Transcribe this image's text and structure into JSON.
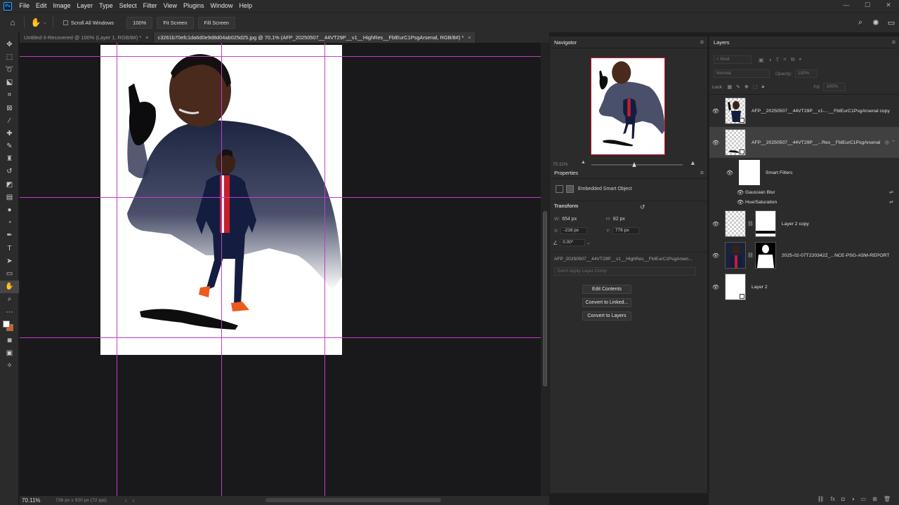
{
  "app": {
    "logo": "Ps",
    "menus": [
      "File",
      "Edit",
      "Image",
      "Layer",
      "Type",
      "Select",
      "Filter",
      "View",
      "Plugins",
      "Window",
      "Help"
    ]
  },
  "options_bar": {
    "scroll_all_windows": "Scroll All Windows",
    "zoom_pct_button": "100%",
    "fit_screen": "Fit Screen",
    "fill_screen": "Fill Screen"
  },
  "tabs": [
    {
      "label": "Untitled-3-Recovered @ 100% (Layer 1, RGB/8#) *",
      "active": false
    },
    {
      "label": "c3261b70efc1da6d0e9d8d04ab025d25.jpg @ 70,1% (AFP_20250507__44VT29P__v1__HighRes__FblEurC1PsgArsenal, RGB/8#) *",
      "active": true
    }
  ],
  "status": {
    "zoom": "70.11%",
    "doc_info": "736 px x 920 px (72 ppi)"
  },
  "navigator": {
    "title": "Navigator",
    "zoom": "70.11%"
  },
  "properties": {
    "title": "Properties",
    "type": "Embedded Smart Object",
    "section": "Transform",
    "w_label": "W:",
    "w_value": "654 px",
    "h_label": "H:",
    "h_value": "82 px",
    "x_label": "X:",
    "x_value": "-216 px",
    "y_label": "Y:",
    "y_value": "776 px",
    "angle_value": "0.00°",
    "linked_name": "AFP_20250507__44VT29P__v1__HighRes__FblEurC1PsgArsen...",
    "layer_comp": "Don't Apply Layer Comp",
    "edit_contents": "Edit Contents",
    "convert_linked": "Convert to Linked...",
    "convert_layers": "Convert to Layers"
  },
  "layers": {
    "title": "Layers",
    "kind": "Kind",
    "blend_mode": "Normal",
    "opacity_label": "Opacity:",
    "opacity_value": "100%",
    "lock_label": "Lock:",
    "fill_label": "Fill:",
    "fill_value": "100%",
    "items": [
      {
        "name": "AFP__20250507__44VT29P__v1-...__FblEurC1PsgArsenal copy"
      },
      {
        "name": "AFP__20250507__44VT29P__...Res__FblEurC1PsgArsenal"
      },
      {
        "name": "Smart Filters"
      },
      {
        "name": "Gaussian Blur"
      },
      {
        "name": "Hue/Saturation"
      },
      {
        "name": "Layer 2 copy"
      },
      {
        "name": "2025-02-07T220342Z_...NCE-PSG-ASM-REPORT"
      },
      {
        "name": "Layer 2"
      }
    ]
  },
  "colors": {
    "foreground": "#ffffff",
    "background": "#e05a14",
    "guide": "#c03ec8",
    "accent_red": "#e0112d"
  }
}
